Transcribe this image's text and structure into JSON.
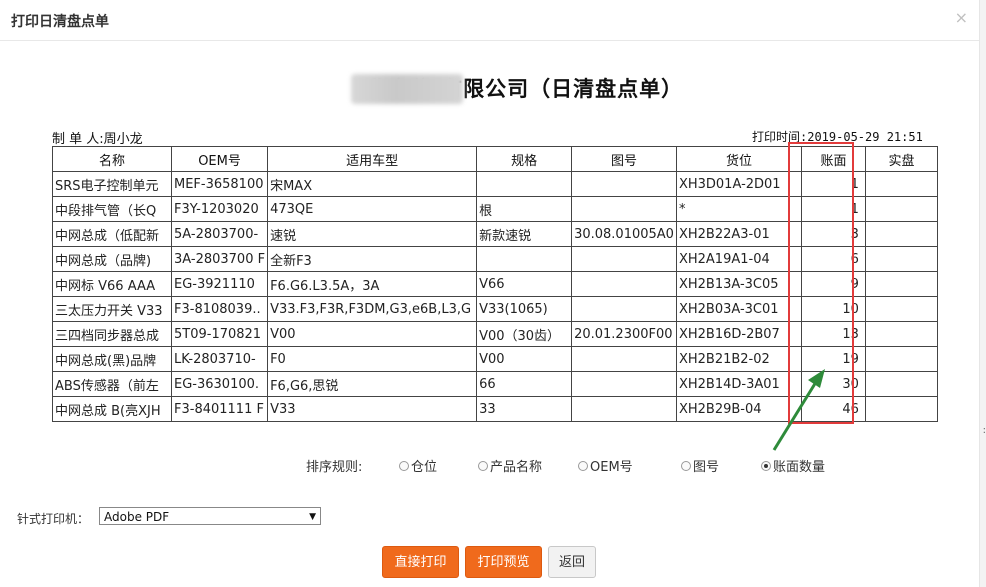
{
  "dialog": {
    "title": "打印日清盘点单",
    "close": "×"
  },
  "report": {
    "title": "北京信                有限公司（日清盘点单）",
    "maker": "制 单 人:周小龙",
    "print_time": "打印时间:2019-05-29 21:51"
  },
  "table": {
    "headers": [
      "名称",
      "OEM号",
      "适用车型",
      "规格",
      "图号",
      "货位",
      "账面",
      "实盘"
    ],
    "rows": [
      [
        "SRS电子控制单元",
        "MEF-3658100",
        "宋MAX",
        "",
        "",
        "XH3D01A-2D01",
        "1",
        ""
      ],
      [
        "中段排气管（长Q",
        "F3Y-1203020",
        "473QE",
        "根",
        "",
        "*",
        "1",
        ""
      ],
      [
        "中网总成（低配新",
        "5A-2803700-",
        "速锐",
        "新款速锐",
        "30.08.01005A0",
        "XH2B22A3-01",
        "3",
        ""
      ],
      [
        "中网总成（品牌)",
        "3A-2803700 F",
        "全新F3",
        "",
        "",
        "XH2A19A1-04",
        "6",
        ""
      ],
      [
        "中网标 V66 AAA",
        "EG-3921110",
        "F6.G6.L3.5A，3A",
        "V66",
        "",
        "XH2B13A-3C05",
        "9",
        ""
      ],
      [
        "三太压力开关 V33",
        "F3-8108039..",
        "V33.F3,F3R,F3DM,G3,e6B,L3,G",
        "V33(1065)",
        "",
        "XH2B03A-3C01",
        "10",
        ""
      ],
      [
        "三四档同步器总成",
        "5T09-170821",
        "V00",
        "V00（30齿）",
        "20.01.2300F00",
        "XH2B16D-2B07",
        "13",
        ""
      ],
      [
        "中网总成(黑)品牌",
        "LK-2803710-",
        "F0",
        "V00",
        "",
        "XH2B21B2-02",
        "19",
        ""
      ],
      [
        "ABS传感器（前左",
        "EG-3630100.",
        "F6,G6,思锐",
        "66",
        "",
        "XH2B14D-3A01",
        "30",
        ""
      ],
      [
        "中网总成 B(亮XJH",
        "F3-8401111 F",
        "V33",
        "33",
        "",
        "XH2B29B-04",
        "46",
        ""
      ]
    ]
  },
  "sort": {
    "label": "排序规则:",
    "options": [
      "仓位",
      "产品名称",
      "OEM号",
      "图号",
      "账面数量"
    ],
    "selected_index": 4
  },
  "printer": {
    "label": "针式打印机：",
    "value": "Adobe PDF"
  },
  "buttons": {
    "print": "直接打印",
    "preview": "打印预览",
    "back": "返回"
  },
  "colors": {
    "accent": "#f06a1c",
    "highlight": "#e23b3b",
    "arrow": "#2e8b3a"
  }
}
